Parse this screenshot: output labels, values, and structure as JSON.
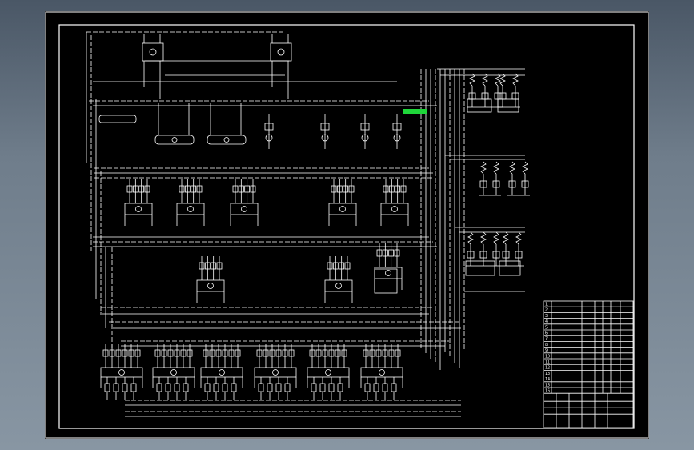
{
  "colors": {
    "background": "#5d6b79",
    "sheet": "#000000",
    "line": "#ffffff",
    "highlight": "#1fd63a"
  },
  "drawing": {
    "title_block": {
      "rows": [
        {
          "no": "1",
          "name": "",
          "qty": ""
        },
        {
          "no": "2",
          "name": "",
          "qty": ""
        },
        {
          "no": "3",
          "name": "",
          "qty": ""
        },
        {
          "no": "4",
          "name": "",
          "qty": ""
        },
        {
          "no": "5",
          "name": "",
          "qty": ""
        },
        {
          "no": "6",
          "name": "",
          "qty": ""
        },
        {
          "no": "7",
          "name": "",
          "qty": ""
        },
        {
          "no": "8",
          "name": "",
          "qty": ""
        },
        {
          "no": "9",
          "name": "",
          "qty": ""
        },
        {
          "no": "10",
          "name": "",
          "qty": ""
        },
        {
          "no": "11",
          "name": "",
          "qty": ""
        },
        {
          "no": "12",
          "name": "",
          "qty": ""
        },
        {
          "no": "13",
          "name": "",
          "qty": ""
        },
        {
          "no": "14",
          "name": "",
          "qty": ""
        },
        {
          "no": "15",
          "name": "",
          "qty": ""
        },
        {
          "no": "16",
          "name": "",
          "qty": ""
        }
      ]
    }
  }
}
